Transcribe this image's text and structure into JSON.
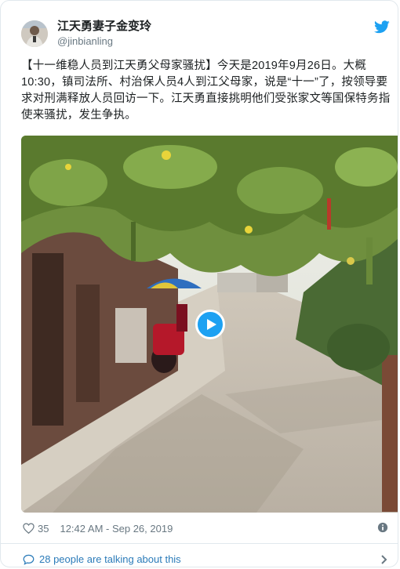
{
  "user": {
    "display_name": "江天勇妻子金变玲",
    "handle": "@jinbianling"
  },
  "tweet": {
    "text": "【十一维稳人员到江天勇父母家骚扰】今天是2019年9月26日。大概10:30，镇司法所、村治保人员4人到江父母家，说是“十一”了，按领导要求对刑满释放人员回访一下。江天勇直接挑明他们受张家文等国保特务指使来骚扰，发生争执。"
  },
  "media": {
    "type": "video",
    "play_icon": "play-icon"
  },
  "footer": {
    "like_count": "35",
    "timestamp": "12:42 AM - Sep 26, 2019",
    "talking_text": "28 people are talking about this"
  },
  "icons": {
    "logo": "twitter-bird-icon",
    "like": "heart-icon",
    "info": "info-icon",
    "talk": "speech-bubble-icon",
    "more": "chevron-right-icon"
  },
  "colors": {
    "accent": "#1da1f2",
    "link": "#2b7bb9",
    "muted": "#697882",
    "border": "#e1e8ed"
  }
}
